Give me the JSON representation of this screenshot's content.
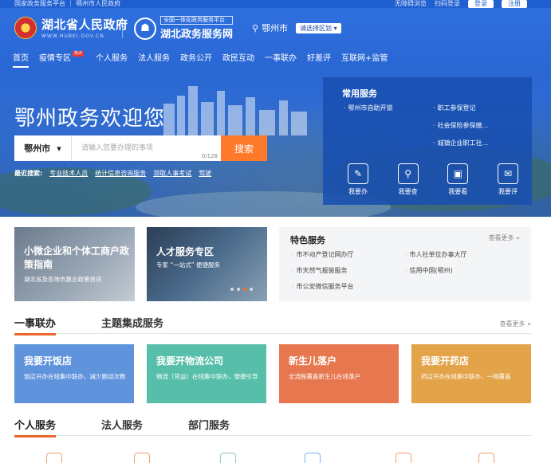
{
  "topbar": {
    "left_text": "国家政务服务平台 ｜ 鄂州市人民政府",
    "right_items": [
      "无障碍浏览",
      "扫码登录"
    ],
    "login": "登录",
    "register": "注册"
  },
  "header": {
    "gov_title": "湖北省人民政府",
    "gov_url": "WWW.HUBEI.GOV.CN",
    "platform_tag": "全国一体化政务服务平台",
    "platform_title": "湖北政务服务网",
    "city": "鄂州市",
    "region_select": "请选择区划"
  },
  "nav": {
    "items": [
      "首页",
      "疫情专区",
      "个人服务",
      "法人服务",
      "政务公开",
      "政民互动",
      "一事联办",
      "好差评",
      "互联网+监管"
    ],
    "hot_badge": "热点"
  },
  "hero": {
    "title": "鄂州政务欢迎您",
    "search_city": "鄂州市",
    "search_placeholder": "请输入您要办理的事项",
    "char_count": "0/128",
    "search_button": "搜索",
    "recent_label": "最近搜索:",
    "recent_keywords": [
      "专业技术人员",
      "统计信息咨询服务",
      "领取人事考试",
      "驾驶"
    ]
  },
  "common_services": {
    "title": "常用服务",
    "links": [
      "鄂州市自助开锁",
      "职工参保登记",
      "社会保险参保缴...",
      "城镇企业职工社..."
    ],
    "actions": [
      "我要办",
      "我要查",
      "我要看",
      "我要评"
    ]
  },
  "banners": {
    "card_a_title": "小微企业和个体工商户政策指南",
    "card_a_sub": "湖北省及各地市惠企政策资讯",
    "card_b_title": "人才服务专区",
    "card_b_sub": "专家 “一站式” 便捷服务"
  },
  "special_services": {
    "title": "特色服务",
    "more": "查看更多",
    "items": [
      "市不动产登记网办厅",
      "市人社单位办事大厅",
      "市天然气报装服务",
      "信用中国(鄂州)",
      "市公安微信服务平台"
    ]
  },
  "section_joint": {
    "tabs": [
      "一事联办",
      "主题集成服务"
    ],
    "more": "查看更多",
    "cards": [
      {
        "title": "我要开饭店",
        "desc": "饭店开办在线集中联办，减少跑动次数",
        "color": "#5f93dc"
      },
      {
        "title": "我要开物流公司",
        "desc": "物流（货运）在线集中联办，便捷引导",
        "color": "#57bfa9"
      },
      {
        "title": "新生儿落户",
        "desc": "全流程覆盖新生儿在线落户",
        "color": "#e6774f"
      },
      {
        "title": "我要开药店",
        "desc": "药店开办在线集中联办，一网覆盖",
        "color": "#e3a349"
      }
    ]
  },
  "section_services": {
    "tabs": [
      "个人服务",
      "法人服务",
      "部门服务"
    ]
  },
  "colors": {
    "primary_blue": "#2a67d4",
    "accent_orange": "#ff7a2b"
  }
}
